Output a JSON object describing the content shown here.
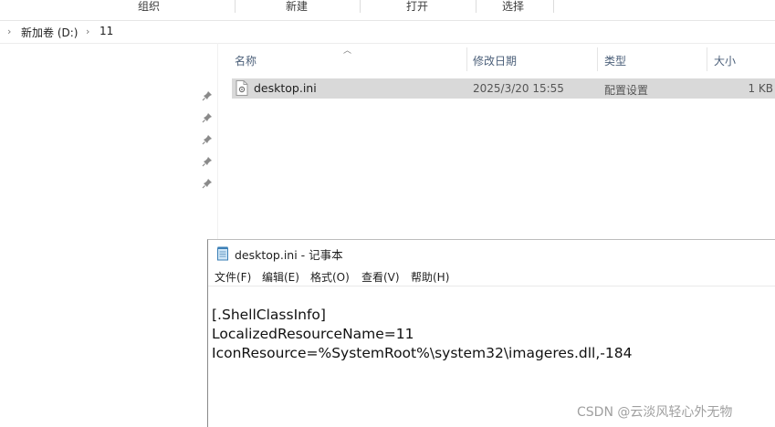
{
  "ribbon": {
    "groups": [
      "组织",
      "新建",
      "打开",
      "选择"
    ]
  },
  "address": {
    "drive": "新加卷 (D:)",
    "folder": "11"
  },
  "nav": {
    "pins": [
      "pin-icon",
      "pin-icon",
      "pin-icon",
      "pin-icon",
      "pin-icon"
    ]
  },
  "columns": {
    "name": "名称",
    "date": "修改日期",
    "type": "类型",
    "size": "大小"
  },
  "files": [
    {
      "name": "desktop.ini",
      "date": "2025/3/20 15:55",
      "type": "配置设置",
      "size": "1 KB",
      "icon": "ini-file-icon"
    }
  ],
  "notepad": {
    "title": "desktop.ini - 记事本",
    "menu": [
      "文件(F)",
      "编辑(E)",
      "格式(O)",
      "查看(V)",
      "帮助(H)"
    ],
    "content": "[.ShellClassInfo]\nLocalizedResourceName=11\nIconResource=%SystemRoot%\\system32\\imageres.dll,-184"
  },
  "watermark": "CSDN @云淡风轻心外无物",
  "colors": {
    "selected_row": "#d9d9d9",
    "header_text": "#4c607a"
  }
}
